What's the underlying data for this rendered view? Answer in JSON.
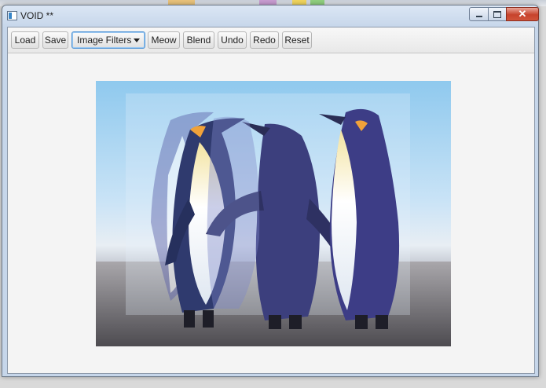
{
  "window": {
    "title": "VOID **",
    "close_glyph": "✕"
  },
  "toolbar": {
    "load_label": "Load",
    "save_label": "Save",
    "filter_select_value": "Image Filters",
    "meow_label": "Meow",
    "blend_label": "Blend",
    "undo_label": "Undo",
    "redo_label": "Redo",
    "reset_label": "Reset"
  },
  "canvas": {
    "image_subject": "blended penguins photo"
  },
  "colors": {
    "accent_focus": "#4a90d4",
    "close_red": "#c7432c"
  }
}
